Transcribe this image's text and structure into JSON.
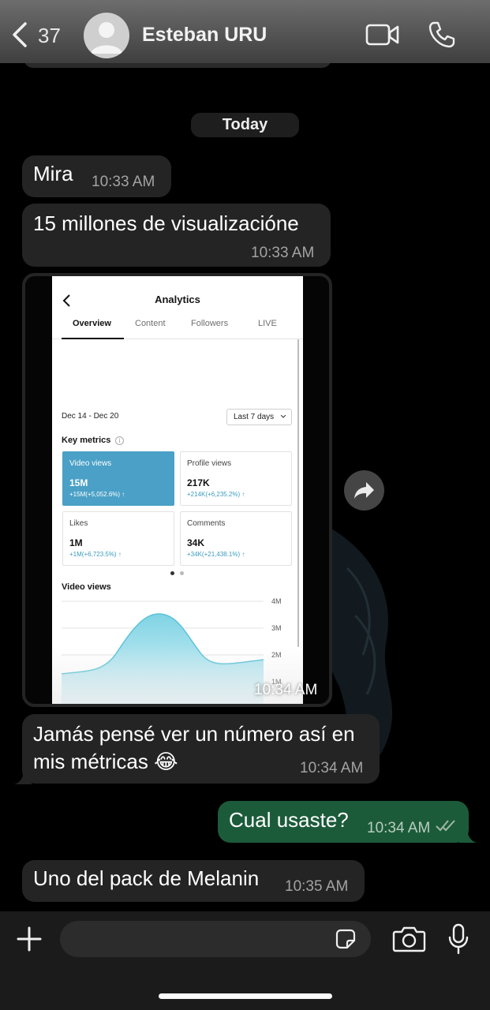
{
  "header": {
    "back_count": "37",
    "contact_name": "Esteban URU"
  },
  "date_chip": "Today",
  "messages": [
    {
      "direction": "in",
      "text": "Mira",
      "time": "10:33 AM"
    },
    {
      "direction": "in",
      "text": "15 millones de visualizacióne",
      "time": "10:33 AM"
    },
    {
      "direction": "in",
      "type": "image",
      "time": "10:34 AM"
    },
    {
      "direction": "in",
      "text": "Jamás pensé ver un número así en mis métricas 😂",
      "time": "10:34 AM"
    },
    {
      "direction": "out",
      "text": "Cual usaste?",
      "time": "10:34 AM",
      "status": "read"
    },
    {
      "direction": "in",
      "text": "Uno del pack de Melanin",
      "time": "10:35 AM"
    }
  ],
  "screenshot": {
    "title": "Analytics",
    "tabs": [
      "Overview",
      "Content",
      "Followers",
      "LIVE"
    ],
    "active_tab": "Overview",
    "date_range": "Dec 14 - Dec 20",
    "period": "Last 7 days",
    "key_metrics_label": "Key metrics",
    "metrics": [
      {
        "label": "Video views",
        "value": "15M",
        "delta": "+15M(+5,052.6%)",
        "active": true
      },
      {
        "label": "Profile views",
        "value": "217K",
        "delta": "+214K(+6,235.2%)",
        "active": false
      },
      {
        "label": "Likes",
        "value": "1M",
        "delta": "+1M(+6,723.5%)",
        "active": false
      },
      {
        "label": "Comments",
        "value": "34K",
        "delta": "+34K(+21,438.1%)",
        "active": false
      }
    ],
    "chart_title": "Video views",
    "y_ticks": [
      "4M",
      "3M",
      "2M",
      "1M"
    ],
    "accent_color": "#4aa0c6"
  },
  "input": {
    "placeholder": ""
  },
  "colors": {
    "incoming_bubble": "#242424",
    "outgoing_bubble": "#1c5b3a",
    "background": "#000000"
  }
}
